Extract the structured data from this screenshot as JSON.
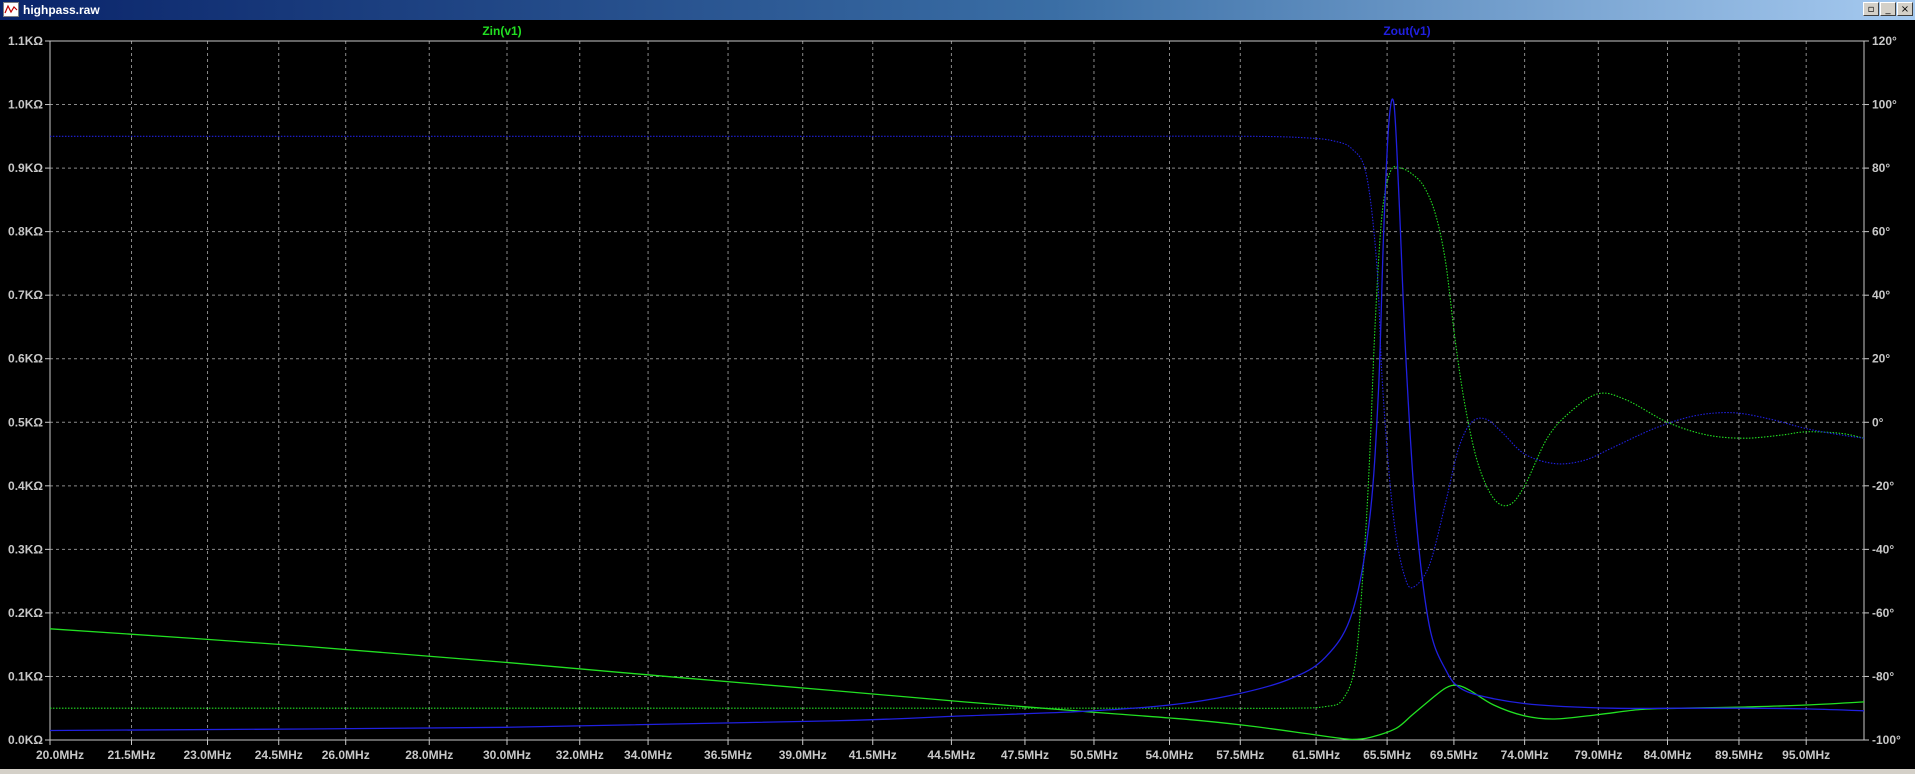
{
  "window": {
    "title": "highpass.raw",
    "buttons": {
      "restore": "▫",
      "minimize": "_",
      "close": "×"
    }
  },
  "colors": {
    "background": "#000000",
    "grid": "#8a8a8a",
    "axis_text": "#c8c8c8",
    "zin": "#22e022",
    "zout": "#2020e0"
  },
  "chart_data": {
    "type": "line",
    "x_ticks": [
      "20.0MHz",
      "21.5MHz",
      "23.0MHz",
      "24.5MHz",
      "26.0MHz",
      "28.0MHz",
      "30.0MHz",
      "32.0MHz",
      "34.0MHz",
      "36.5MHz",
      "39.0MHz",
      "41.5MHz",
      "44.5MHz",
      "47.5MHz",
      "50.5MHz",
      "54.0MHz",
      "57.5MHz",
      "61.5MHz",
      "65.5MHz",
      "69.5MHz",
      "74.0MHz",
      "79.0MHz",
      "84.0MHz",
      "89.5MHz",
      "95.0MHz"
    ],
    "x_tick_values": [
      20.0,
      21.5,
      23.0,
      24.5,
      26.0,
      28.0,
      30.0,
      32.0,
      34.0,
      36.5,
      39.0,
      41.5,
      44.5,
      47.5,
      50.5,
      54.0,
      57.5,
      61.5,
      65.5,
      69.5,
      74.0,
      79.0,
      84.0,
      89.5,
      95.0
    ],
    "x_scale": "log",
    "xlim": [
      20.0,
      100.0
    ],
    "y_left_ticks": [
      "0.0KΩ",
      "0.1KΩ",
      "0.2KΩ",
      "0.3KΩ",
      "0.4KΩ",
      "0.5KΩ",
      "0.6KΩ",
      "0.7KΩ",
      "0.8KΩ",
      "0.9KΩ",
      "1.0KΩ",
      "1.1KΩ"
    ],
    "y_left_values": [
      0,
      0.1,
      0.2,
      0.3,
      0.4,
      0.5,
      0.6,
      0.7,
      0.8,
      0.9,
      1.0,
      1.1
    ],
    "ylim_left": [
      0,
      1.1
    ],
    "y_right_ticks": [
      "-100°",
      "-80°",
      "-60°",
      "-40°",
      "-20°",
      "0°",
      "20°",
      "40°",
      "60°",
      "80°",
      "100°",
      "120°"
    ],
    "y_right_values": [
      -100,
      -80,
      -60,
      -40,
      -20,
      0,
      20,
      40,
      60,
      80,
      100,
      120
    ],
    "ylim_right": [
      -100,
      120
    ],
    "grid": true,
    "series": [
      {
        "name": "Zin(v1)",
        "color": "#22e022",
        "magnitude": [
          [
            20,
            0.175
          ],
          [
            25,
            0.148
          ],
          [
            30,
            0.122
          ],
          [
            35,
            0.098
          ],
          [
            40,
            0.078
          ],
          [
            45,
            0.06
          ],
          [
            50,
            0.045
          ],
          [
            55,
            0.032
          ],
          [
            58,
            0.022
          ],
          [
            61,
            0.01
          ],
          [
            62.5,
            0.004
          ],
          [
            63.5,
            0.001
          ],
          [
            64.5,
            0.004
          ],
          [
            66,
            0.018
          ],
          [
            67,
            0.04
          ],
          [
            68,
            0.062
          ],
          [
            69,
            0.082
          ],
          [
            69.7,
            0.086
          ],
          [
            70.5,
            0.078
          ],
          [
            72,
            0.055
          ],
          [
            74,
            0.038
          ],
          [
            76,
            0.033
          ],
          [
            79,
            0.04
          ],
          [
            82,
            0.048
          ],
          [
            85,
            0.05
          ],
          [
            90,
            0.052
          ],
          [
            95,
            0.055
          ],
          [
            100,
            0.06
          ]
        ],
        "phase": [
          [
            20,
            -90
          ],
          [
            40,
            -90
          ],
          [
            55,
            -90
          ],
          [
            60,
            -90
          ],
          [
            62,
            -89.5
          ],
          [
            63,
            -87
          ],
          [
            63.7,
            -75
          ],
          [
            64.2,
            -40
          ],
          [
            64.5,
            -10
          ],
          [
            64.8,
            30
          ],
          [
            65.2,
            65
          ],
          [
            65.7,
            79
          ],
          [
            66.3,
            80
          ],
          [
            67,
            78
          ],
          [
            67.7,
            74
          ],
          [
            68.4,
            65
          ],
          [
            69.0,
            50
          ],
          [
            69.6,
            25
          ],
          [
            70.2,
            5
          ],
          [
            71,
            -13
          ],
          [
            72,
            -24
          ],
          [
            73,
            -26
          ],
          [
            74,
            -20
          ],
          [
            75.5,
            -5
          ],
          [
            77,
            3
          ],
          [
            79,
            9
          ],
          [
            81,
            7
          ],
          [
            84,
            0
          ],
          [
            87,
            -4
          ],
          [
            90,
            -5
          ],
          [
            93,
            -4
          ],
          [
            95,
            -3
          ],
          [
            98,
            -3.5
          ],
          [
            100,
            -5
          ]
        ]
      },
      {
        "name": "Zout(v1)",
        "color": "#2020e0",
        "magnitude": [
          [
            20,
            0.015
          ],
          [
            30,
            0.02
          ],
          [
            40,
            0.03
          ],
          [
            45,
            0.038
          ],
          [
            50,
            0.045
          ],
          [
            54,
            0.055
          ],
          [
            57,
            0.07
          ],
          [
            60,
            0.095
          ],
          [
            62,
            0.13
          ],
          [
            63.5,
            0.2
          ],
          [
            64.5,
            0.35
          ],
          [
            65,
            0.55
          ],
          [
            65.3,
            0.8
          ],
          [
            65.6,
            0.97
          ],
          [
            65.9,
            1.0
          ],
          [
            66.2,
            0.85
          ],
          [
            66.6,
            0.6
          ],
          [
            67.2,
            0.35
          ],
          [
            68,
            0.18
          ],
          [
            69,
            0.11
          ],
          [
            70,
            0.08
          ],
          [
            72,
            0.065
          ],
          [
            75,
            0.055
          ],
          [
            80,
            0.05
          ],
          [
            85,
            0.05
          ],
          [
            90,
            0.05
          ],
          [
            95,
            0.049
          ],
          [
            100,
            0.046
          ]
        ],
        "phase": [
          [
            20,
            90
          ],
          [
            30,
            90
          ],
          [
            40,
            90
          ],
          [
            50,
            90
          ],
          [
            58,
            90
          ],
          [
            61,
            89.5
          ],
          [
            62.5,
            88.5
          ],
          [
            63.5,
            86
          ],
          [
            64.3,
            78
          ],
          [
            64.9,
            50
          ],
          [
            65.2,
            15
          ],
          [
            65.6,
            -15
          ],
          [
            66.0,
            -35
          ],
          [
            66.5,
            -48
          ],
          [
            67,
            -52
          ],
          [
            68,
            -45
          ],
          [
            69,
            -25
          ],
          [
            69.8,
            -8
          ],
          [
            70.6,
            0
          ],
          [
            71.5,
            1
          ],
          [
            72.5,
            -3
          ],
          [
            74,
            -10
          ],
          [
            76,
            -13
          ],
          [
            78,
            -12
          ],
          [
            80,
            -8
          ],
          [
            83,
            -2
          ],
          [
            86,
            2
          ],
          [
            89,
            3
          ],
          [
            92,
            1
          ],
          [
            95,
            -2
          ],
          [
            98,
            -4
          ],
          [
            100,
            -5
          ]
        ]
      }
    ]
  }
}
